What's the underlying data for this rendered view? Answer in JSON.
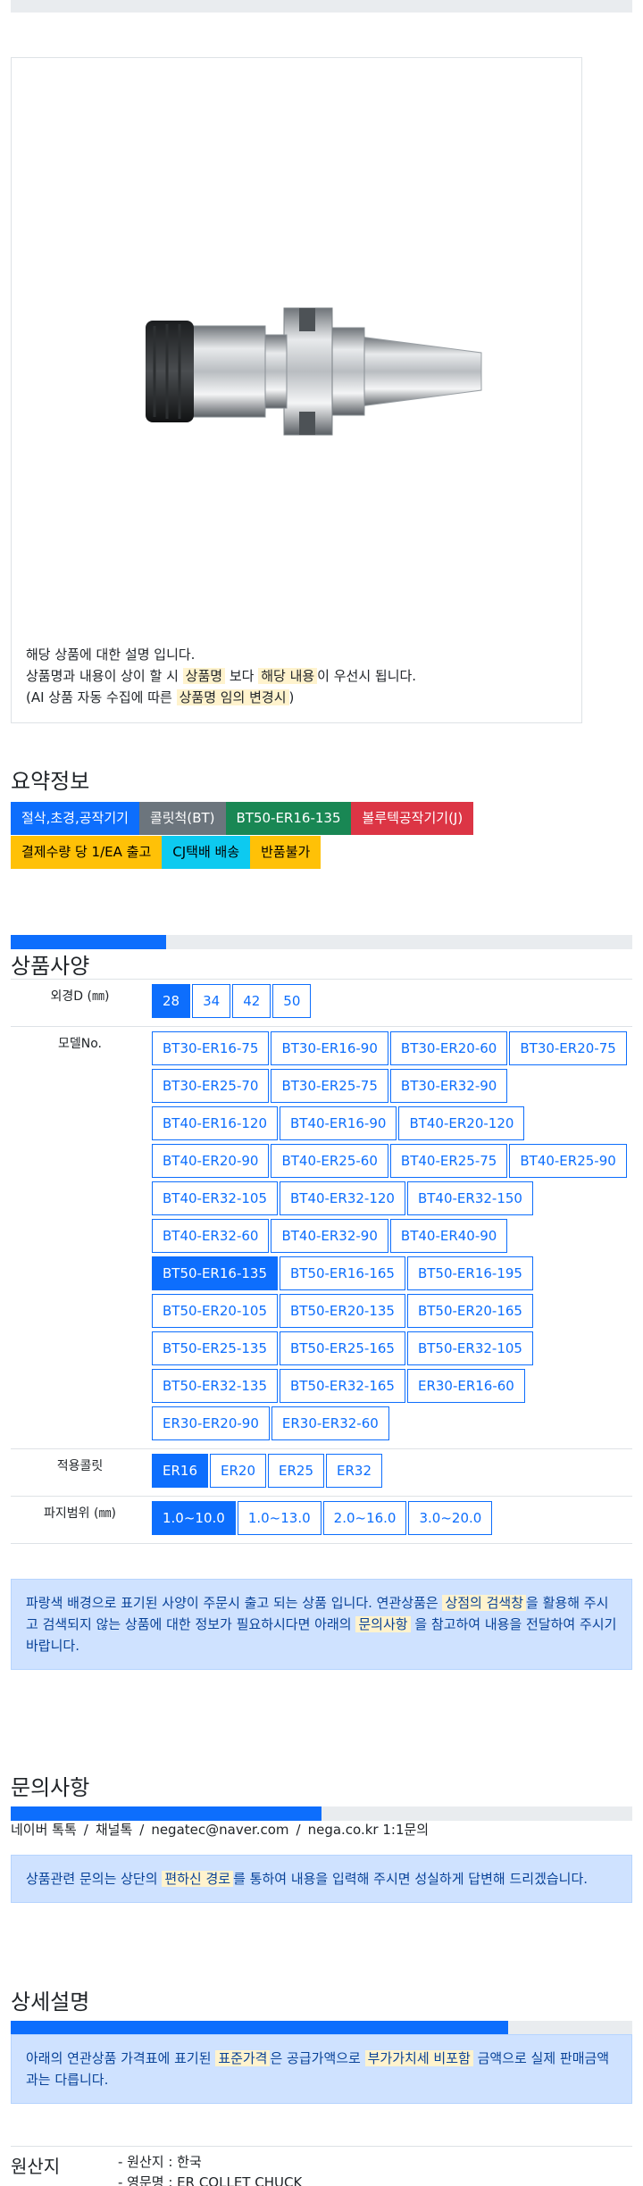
{
  "product": {
    "image_alt": "BT50-ER16-135 collet chuck",
    "note_line1": "해당 상품에 대한 설명 입니다.",
    "note_line2_pre": "상품명과 내용이 상이 할 시 ",
    "note_line2_hl1": "상품명",
    "note_line2_mid": " 보다 ",
    "note_line2_hl2": "해당 내용",
    "note_line2_post": "이 우선시 됩니다.",
    "note_line3_pre": "(AI 상품 자동 수집에 따른 ",
    "note_line3_hl": "상품명 임의 변경시",
    "note_line3_post": ")"
  },
  "summary": {
    "title": "요약정보",
    "badges_row1": [
      "절삭,초경,공작기기",
      "콜릿척(BT)",
      "BT50-ER16-135",
      "볼루텍공작기기(J)"
    ],
    "badges_row2": [
      "결제수량 당 1/EA 출고",
      "CJ택배 배송",
      "반품불가"
    ]
  },
  "spec": {
    "progress": 0.25,
    "title": "상품사양",
    "rows": [
      {
        "label": "외경D (㎜)",
        "options": [
          "28",
          "34",
          "42",
          "50"
        ],
        "selected": "28"
      },
      {
        "label": "모델No.",
        "options": [
          "BT30-ER16-75",
          "BT30-ER16-90",
          "BT30-ER20-60",
          "BT30-ER20-75",
          "BT30-ER25-70",
          "BT30-ER25-75",
          "BT30-ER32-90",
          "BT40-ER16-120",
          "BT40-ER16-90",
          "BT40-ER20-120",
          "BT40-ER20-90",
          "BT40-ER25-60",
          "BT40-ER25-75",
          "BT40-ER25-90",
          "BT40-ER32-105",
          "BT40-ER32-120",
          "BT40-ER32-150",
          "BT40-ER32-60",
          "BT40-ER32-90",
          "BT40-ER40-90",
          "BT50-ER16-135",
          "BT50-ER16-165",
          "BT50-ER16-195",
          "BT50-ER20-105",
          "BT50-ER20-135",
          "BT50-ER20-165",
          "BT50-ER25-135",
          "BT50-ER25-165",
          "BT50-ER32-105",
          "BT50-ER32-135",
          "BT50-ER32-165",
          "ER30-ER16-60",
          "ER30-ER20-90",
          "ER30-ER32-60"
        ],
        "selected": "BT50-ER16-135"
      },
      {
        "label": "적용콜릿",
        "options": [
          "ER16",
          "ER20",
          "ER25",
          "ER32"
        ],
        "selected": "ER16"
      },
      {
        "label": "파지범위 (㎜)",
        "options": [
          "1.0~10.0",
          "1.0~13.0",
          "2.0~16.0",
          "3.0~20.0"
        ],
        "selected": "1.0~10.0"
      }
    ],
    "notice_pre": "파랑색 배경으로 표기된 사양이 주문시 출고 되는 상품 입니다. 연관상품은 ",
    "notice_hl1": "상점의 검색창",
    "notice_mid": "을 활용해 주시고 검색되지 않는 상품에 대한 정보가 필요하시다면 아래의 ",
    "notice_hl2": "문의사항",
    "notice_post": " 을 참고하여 내용을 전달하여 주시기 바랍니다."
  },
  "inquiry": {
    "title": "문의사항",
    "progress": 0.5,
    "contacts": [
      "네이버 톡톡",
      "채널톡",
      "negatec@naver.com",
      "nega.co.kr 1:1문의"
    ],
    "notice_pre": "상품관련 문의는 상단의 ",
    "notice_hl": "편하신 경로",
    "notice_post": "를 통하여 내용을 입력해 주시면 성실하게 답변해 드리겠습니다."
  },
  "detail": {
    "title": "상세설명",
    "progress": 0.8,
    "notice_pre": "아래의 연관상품 가격표에 표기된 ",
    "notice_hl1": "표준가격",
    "notice_mid": "은 공급가액으로 ",
    "notice_hl2": "부가가치세 비포함",
    "notice_post": " 금액으로 실제 판매금액과는 다릅니다.",
    "origin_label": "원산지",
    "origin_items": [
      "- 원산지 : 한국",
      "- 영문명 : ER COLLET CHUCK"
    ]
  }
}
